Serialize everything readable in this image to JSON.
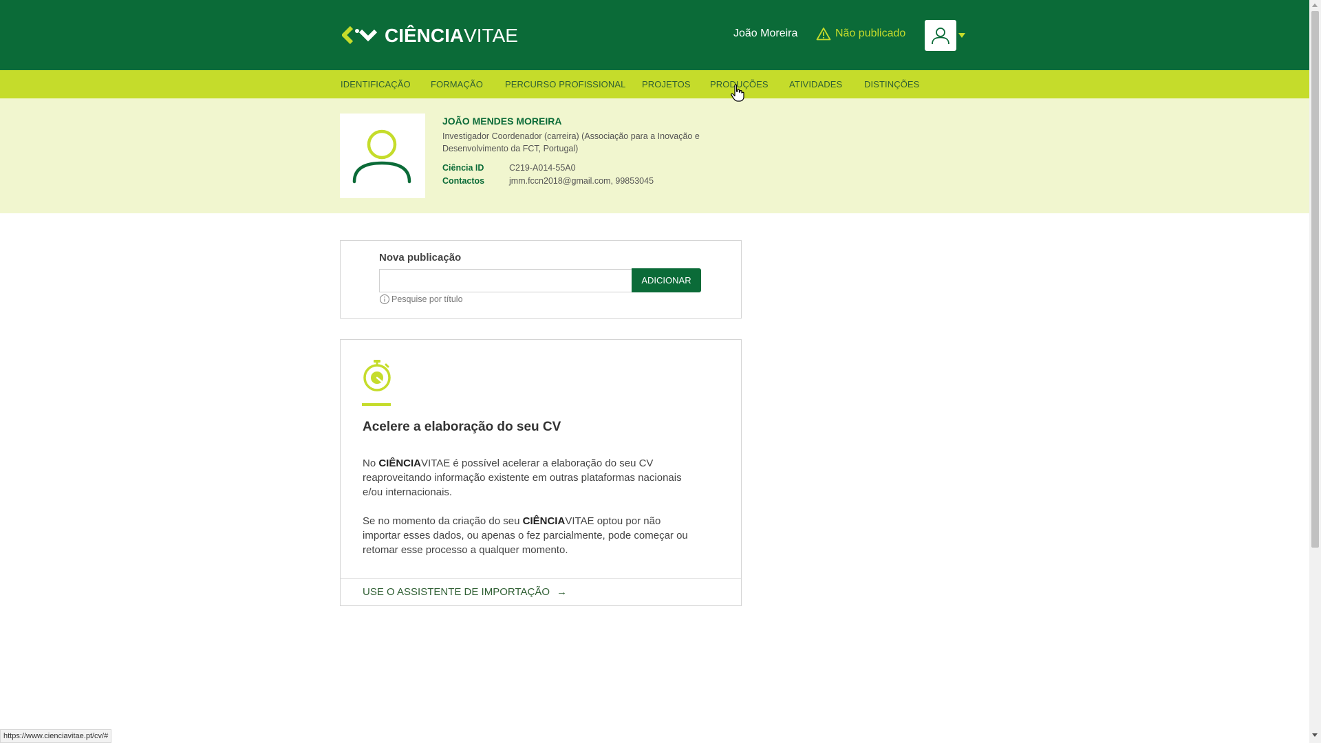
{
  "header": {
    "logo_bold": "CIÊNCIA",
    "logo_light": "VITAE",
    "user_name": "João Moreira",
    "status_label": "Não publicado",
    "user_menu_icon": "user-icon",
    "status_icon": "warning-icon"
  },
  "nav": {
    "items": [
      {
        "label": "IDENTIFICAÇÃO"
      },
      {
        "label": "FORMAÇÃO"
      },
      {
        "label": "PERCURSO PROFISSIONAL"
      },
      {
        "label": "PROJETOS"
      },
      {
        "label": "PRODUÇÕES"
      },
      {
        "label": "ATIVIDADES"
      },
      {
        "label": "DISTINÇÕES"
      }
    ]
  },
  "profile": {
    "name": "JOÃO MENDES MOREIRA",
    "position_line1": "Investigador Coordenador (carreira) (Associação para a Inovação e",
    "position_line2": "Desenvolvimento da FCT, Portugal)",
    "ciencia_id_label": "Ciência ID",
    "ciencia_id_value": "C219-A014-55A0",
    "contacts_label": "Contactos",
    "contacts_value": "jmm.fccn2018@gmail.com, 99853045"
  },
  "new_publication": {
    "title": "Nova publicação",
    "input_value": "",
    "add_label": "ADICIONAR",
    "hint": "Pesquise por título"
  },
  "import_card": {
    "title": "Acelere a elaboração do seu CV",
    "p1_prefix": "No ",
    "p1_brand_bold": "CIÊNCIA",
    "p1_brand_light": "VITAE",
    "p1_suffix": " é possível acelerar a elaboração do seu CV",
    "p1_line2": "reaproveitando informação existente em outras plataformas nacionais",
    "p1_line3": "e/ou internacionais.",
    "p2_prefix": "Se no momento da criação do seu ",
    "p2_brand_bold": "CIÊNCIA",
    "p2_brand_light": "VITAE",
    "p2_suffix": " optou por não",
    "p2_line2": "importar esses dados, ou apenas o fez parcialmente, pode começar ou",
    "p2_line3": "retomar esse processo a qualquer momento.",
    "link_label": "USE O ASSISTENTE DE IMPORTAÇÃO",
    "link_arrow": "→"
  },
  "status_bar": {
    "url": "https://www.cienciavitae.pt/cv/#"
  },
  "colors": {
    "header_green": "#0b6b38",
    "accent_lime": "#c5dc2b",
    "profile_band": "#f1f6cf"
  }
}
